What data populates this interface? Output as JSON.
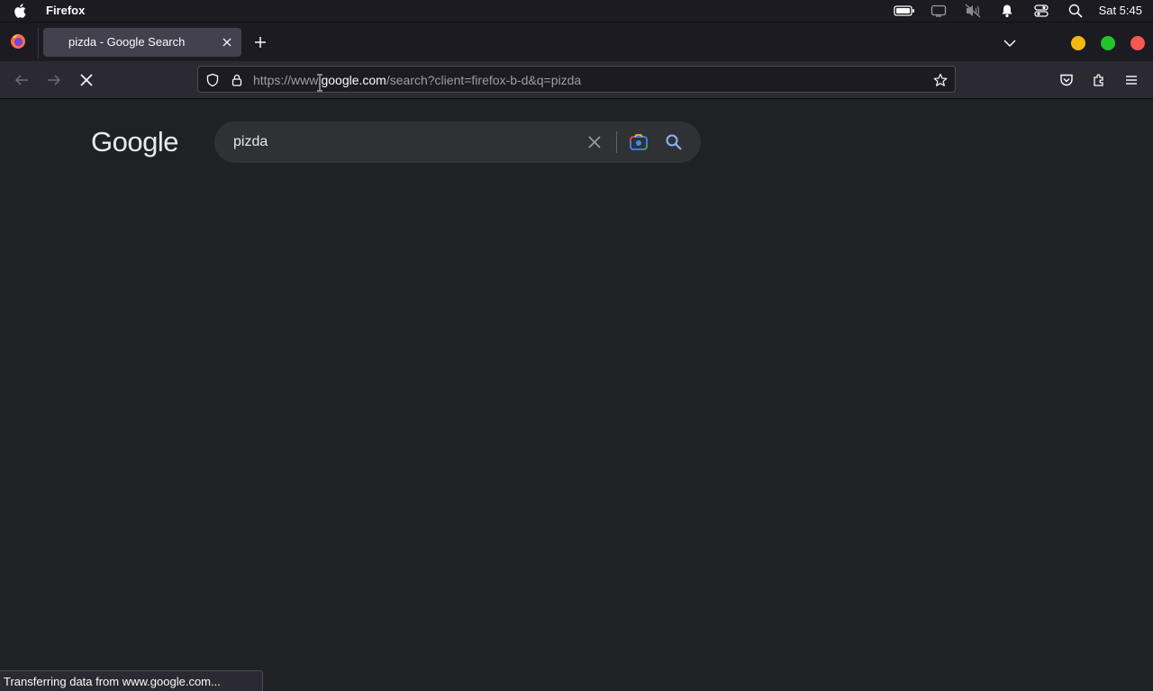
{
  "menubar": {
    "app_name": "Firefox",
    "clock": "Sat 5:45"
  },
  "tabs": [
    {
      "title": "pizda - Google Search",
      "active": true
    }
  ],
  "urlbar": {
    "url_prefix": "https://www.",
    "url_host": "google.com",
    "url_path": "/search?client=firefox-b-d&q=pizda"
  },
  "page": {
    "logo_text": "Google",
    "search_query": "pizda"
  },
  "statusbar": {
    "text": "Transferring data from www.google.com..."
  },
  "colors": {
    "window_minimize": "#f6b70f",
    "window_maximize": "#22c32d",
    "window_close": "#f85750"
  }
}
